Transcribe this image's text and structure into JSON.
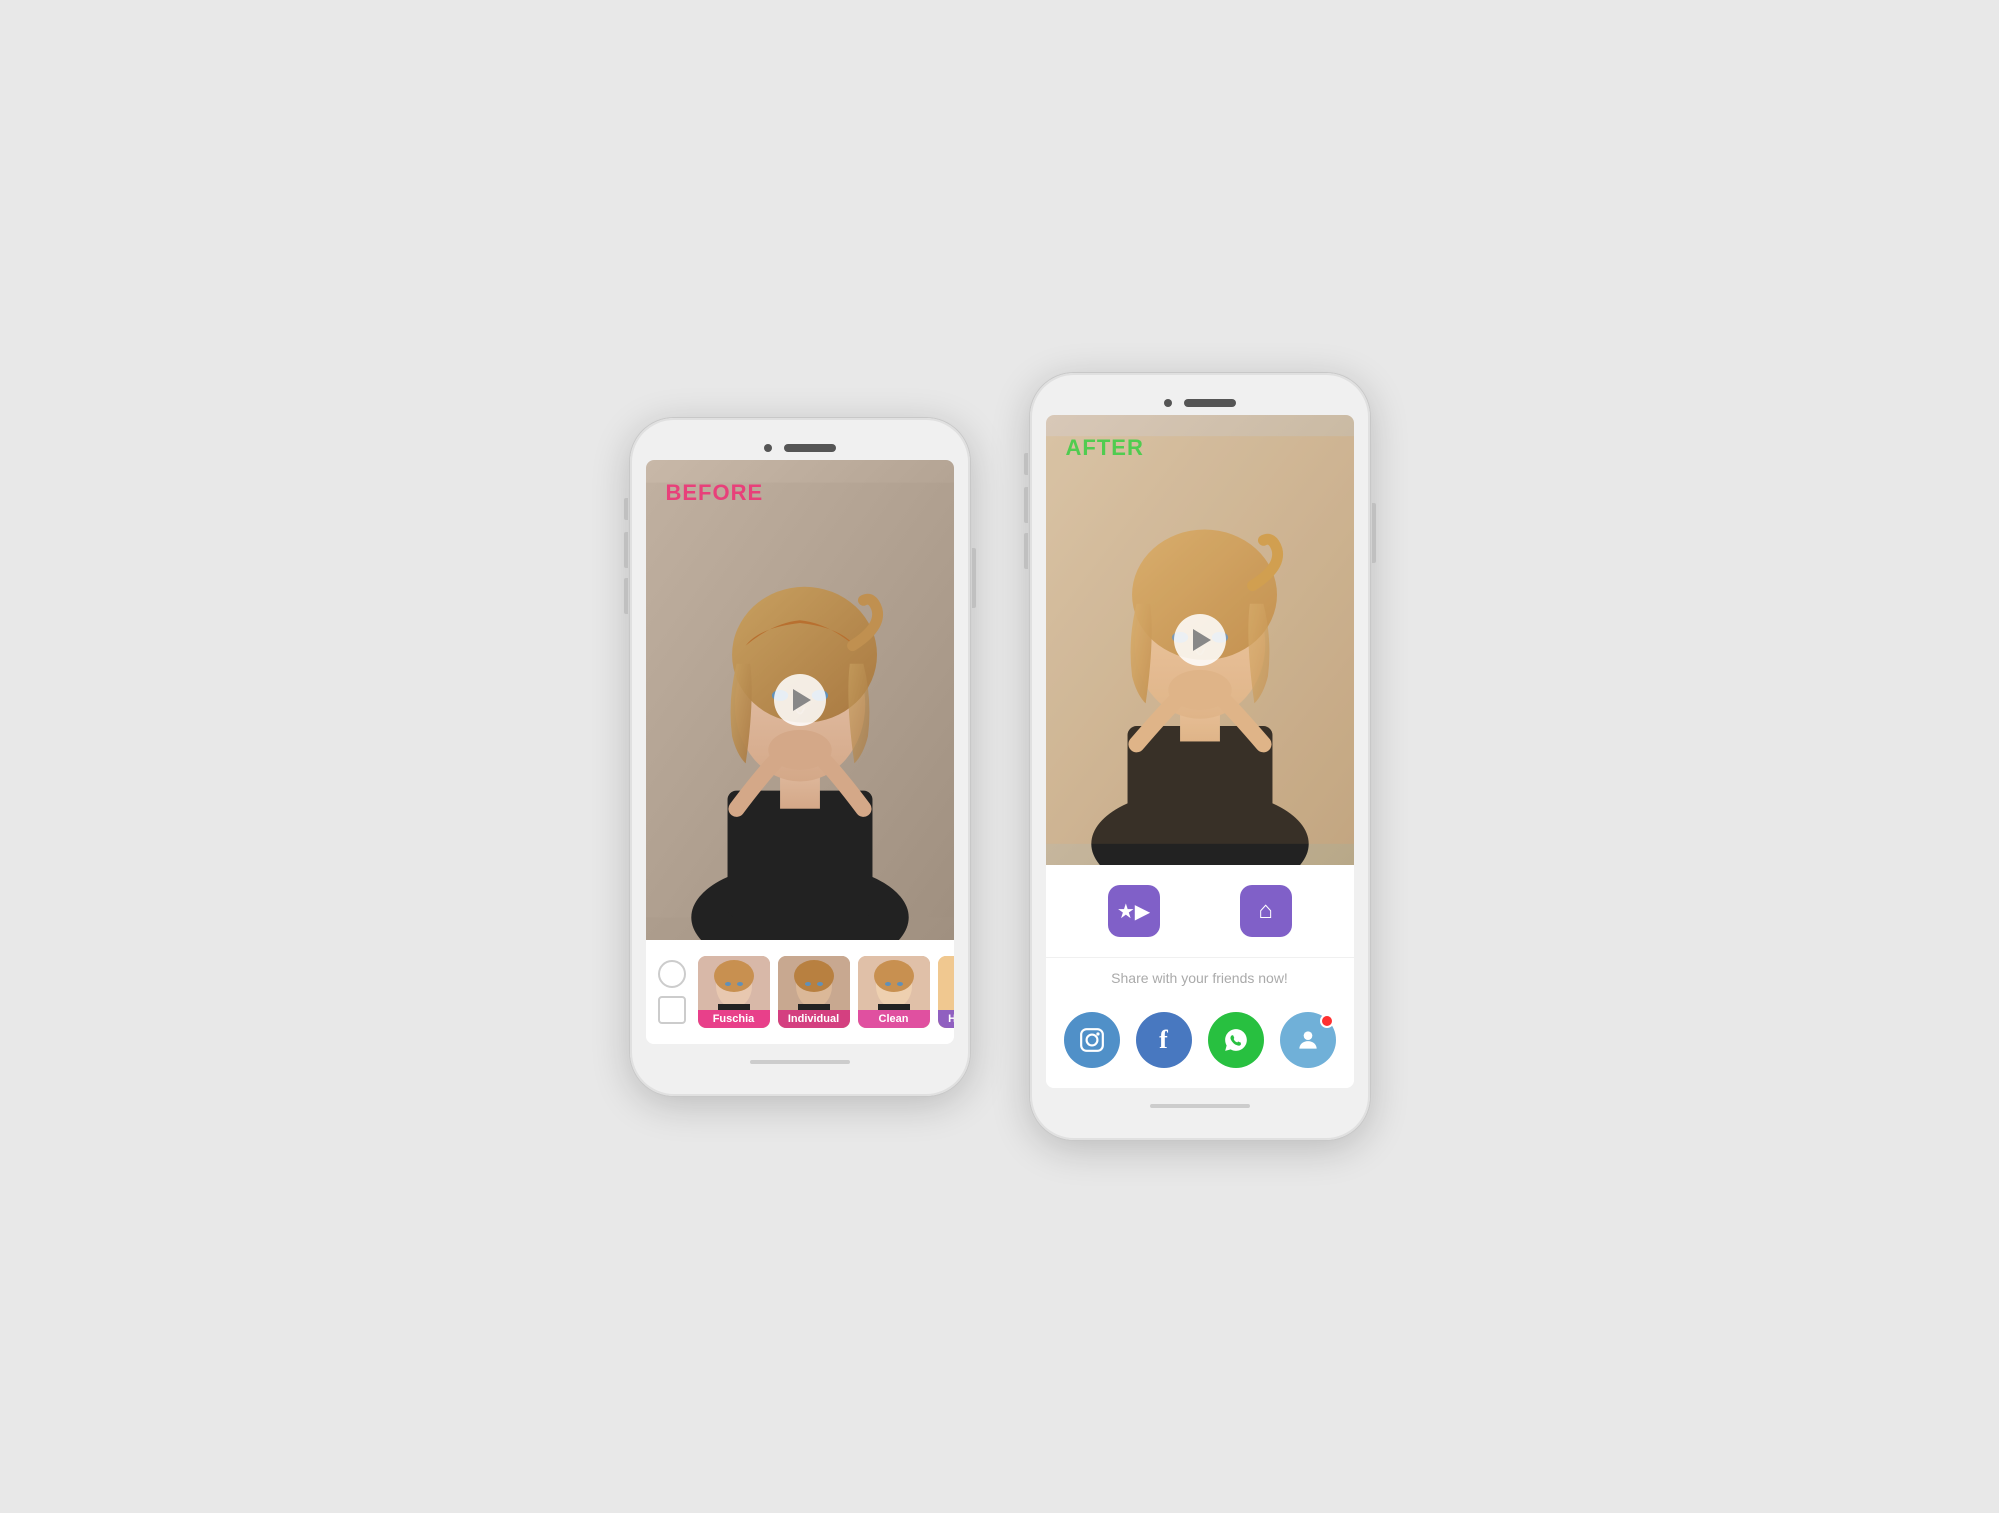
{
  "left_phone": {
    "before_label": "BEFORE",
    "filters": [
      {
        "name": "Fuschia",
        "label_class": "label-fuschia",
        "face_class": "face-fuschia"
      },
      {
        "name": "Individual",
        "label_class": "label-individual",
        "face_class": "face-individual"
      },
      {
        "name": "Clean",
        "label_class": "label-clean",
        "face_class": "face-clean"
      },
      {
        "name": "Heatwave",
        "label_class": "label-heatwave",
        "face_class": "face-heatwave"
      }
    ]
  },
  "right_phone": {
    "after_label": "AFTER",
    "action_buttons": [
      {
        "name": "save-video",
        "icon": "★▶"
      },
      {
        "name": "home",
        "icon": "⌂"
      }
    ],
    "share_text": "Share with your friends now!",
    "share_buttons": [
      {
        "name": "instagram",
        "class": "share-btn-instagram",
        "icon": "📷"
      },
      {
        "name": "facebook",
        "class": "share-btn-facebook",
        "icon": "f"
      },
      {
        "name": "whatsapp",
        "class": "share-btn-whatsapp",
        "icon": "✆"
      },
      {
        "name": "profile",
        "class": "share-btn-profile",
        "icon": "👤",
        "badge": true
      }
    ]
  },
  "colors": {
    "before_label": "#e8407a",
    "after_label": "#50cc50",
    "action_purple": "#8060c8"
  }
}
